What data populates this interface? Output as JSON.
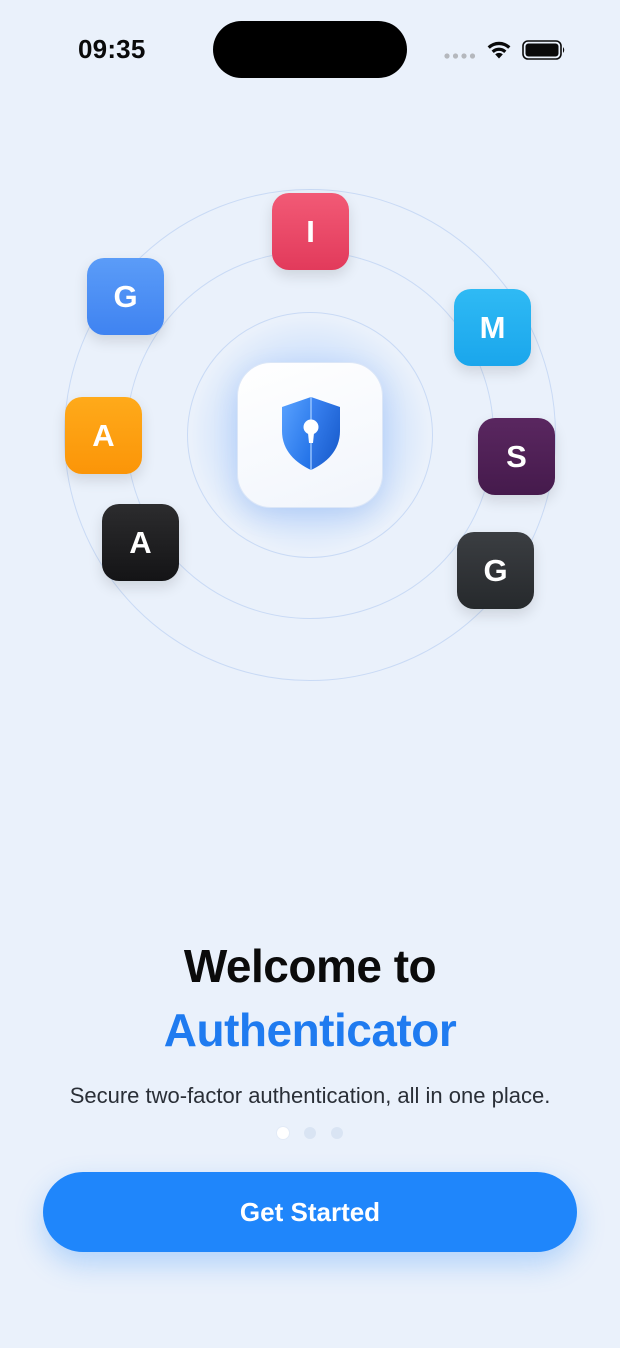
{
  "status_bar": {
    "time": "09:35",
    "icons": [
      "cellular-signal-icon",
      "wifi-icon",
      "battery-icon"
    ]
  },
  "illustration": {
    "center_icon": "shield-keyhole-icon",
    "app_tiles": [
      {
        "letter": "I",
        "color": "#e8425f"
      },
      {
        "letter": "G",
        "color": "#4a8cf4"
      },
      {
        "letter": "M",
        "color": "#22aff0"
      },
      {
        "letter": "A",
        "color": "#fc9b0c"
      },
      {
        "letter": "S",
        "color": "#4d1f55"
      },
      {
        "letter": "A",
        "color": "#1c1c1e"
      },
      {
        "letter": "G",
        "color": "#2e3135"
      }
    ]
  },
  "onboarding": {
    "title_line1": "Welcome to",
    "title_line2": "Authenticator",
    "subtitle": "Secure two-factor authentication, all in one place.",
    "page_count": 3,
    "current_page": 1,
    "cta_label": "Get Started"
  },
  "colors": {
    "background": "#eaf1fb",
    "accent": "#1f86fb",
    "title_accent": "#1f7bf0"
  }
}
